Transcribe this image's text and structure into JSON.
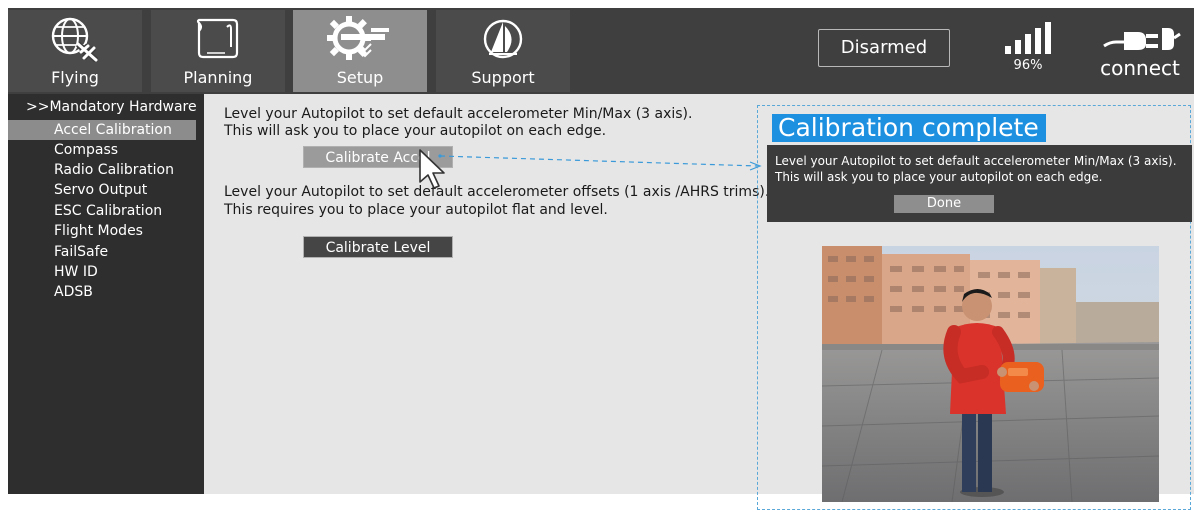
{
  "nav": {
    "flying": "Flying",
    "planning": "Planning",
    "setup": "Setup",
    "support": "Support"
  },
  "status": {
    "arm_state": "Disarmed",
    "signal_percent": "96%",
    "connect_label": "connect"
  },
  "sidebar": {
    "header": ">>Mandatory Hardware",
    "items": [
      {
        "label": "Accel Calibration",
        "selected": true
      },
      {
        "label": "Compass"
      },
      {
        "label": "Radio Calibration"
      },
      {
        "label": "Servo Output"
      },
      {
        "label": "ESC Calibration"
      },
      {
        "label": "Flight Modes"
      },
      {
        "label": "FailSafe"
      },
      {
        "label": "HW ID"
      },
      {
        "label": "ADSB"
      }
    ]
  },
  "main": {
    "accel_text_1": "Level your Autopilot to set default accelerometer Min/Max (3 axis).",
    "accel_text_2": "This will ask you to place your autopilot on each edge.",
    "calibrate_accel": "Calibrate Accel",
    "level_text_1": "Level your Autopilot to set default accelerometer offsets (1 axis /AHRS trims).",
    "level_text_2": "This requires you to place your autopilot flat and level.",
    "calibrate_level": "Calibrate Level"
  },
  "calibration": {
    "title": "Calibration complete",
    "line_1": "Level your Autopilot to set default accelerometer Min/Max (3 axis).",
    "line_2": "This will ask you to place your autopilot on each edge.",
    "done": "Done"
  },
  "colors": {
    "toolbar": "#3f3f3f",
    "active_tab": "#8e8e8e",
    "sidebar": "#2e2e2e",
    "panel": "#e6e6e6",
    "accent": "#1e90e0"
  }
}
